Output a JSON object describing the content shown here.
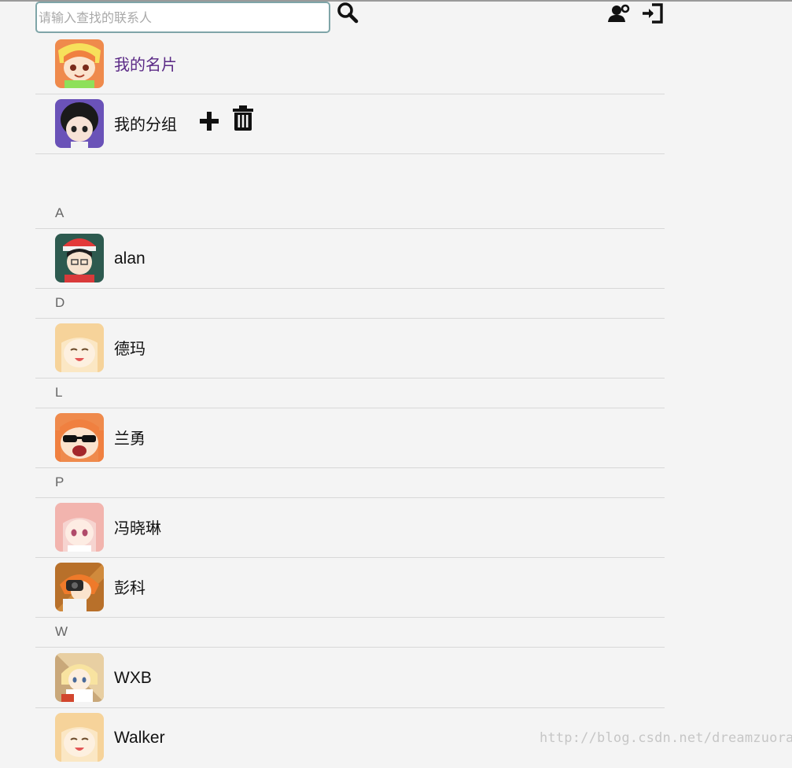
{
  "search": {
    "placeholder": "请输入查找的联系人",
    "value": ""
  },
  "toolbar": {
    "search_icon": "search-icon",
    "add_user_icon": "user-add-icon",
    "logout_icon": "sign-in-icon"
  },
  "top_items": {
    "card": {
      "label": "我的名片",
      "color": "#5b2a86"
    },
    "groups": {
      "label": "我的分组",
      "add_icon": "plus-icon",
      "delete_icon": "trash-icon"
    }
  },
  "sections": [
    {
      "letter": "A",
      "contacts": [
        {
          "name": "alan"
        }
      ]
    },
    {
      "letter": "D",
      "contacts": [
        {
          "name": "德玛"
        }
      ]
    },
    {
      "letter": "L",
      "contacts": [
        {
          "name": "兰勇"
        }
      ]
    },
    {
      "letter": "P",
      "contacts": [
        {
          "name": "冯晓琳"
        },
        {
          "name": "彭科"
        }
      ]
    },
    {
      "letter": "W",
      "contacts": [
        {
          "name": "WXB"
        },
        {
          "name": "Walker"
        }
      ]
    }
  ],
  "watermark": "http://blog.csdn.net/dreamzuora"
}
